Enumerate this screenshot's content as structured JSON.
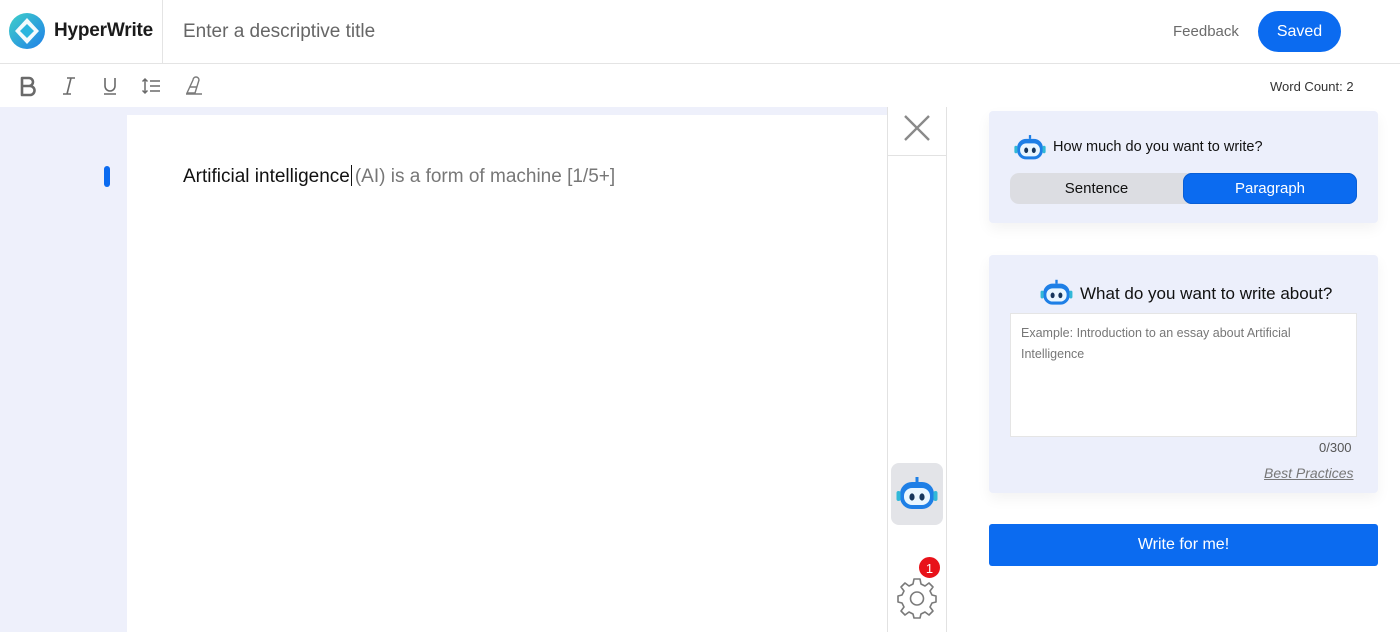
{
  "header": {
    "brand": "HyperWrite",
    "title_placeholder": "Enter a descriptive title",
    "feedback_label": "Feedback",
    "saved_label": "Saved"
  },
  "toolbar": {
    "icons": [
      "bold-icon",
      "italic-icon",
      "underline-icon",
      "line-height-icon",
      "clear-format-icon"
    ],
    "word_count_label": "Word Count:",
    "word_count": "2"
  },
  "editor": {
    "typed_text": "Artificial intelligence",
    "suggestion_text": "(AI) is a form of machine [1/5+]"
  },
  "side_column": {
    "notification_count": "1"
  },
  "length_panel": {
    "question": "How much do you want to write?",
    "options": [
      "Sentence",
      "Paragraph"
    ],
    "selected": "Paragraph"
  },
  "topic_panel": {
    "question": "What do you want to write about?",
    "placeholder": "Example: Introduction to an essay about Artificial Intelligence",
    "value": "",
    "char_count": "0/300",
    "best_practices_label": "Best Practices"
  },
  "write_button_label": "Write for me!",
  "colors": {
    "accent": "#0b6bf0",
    "editor_bg": "#eef0fb",
    "panel_bg": "#eceffb",
    "badge": "#e8121a"
  }
}
